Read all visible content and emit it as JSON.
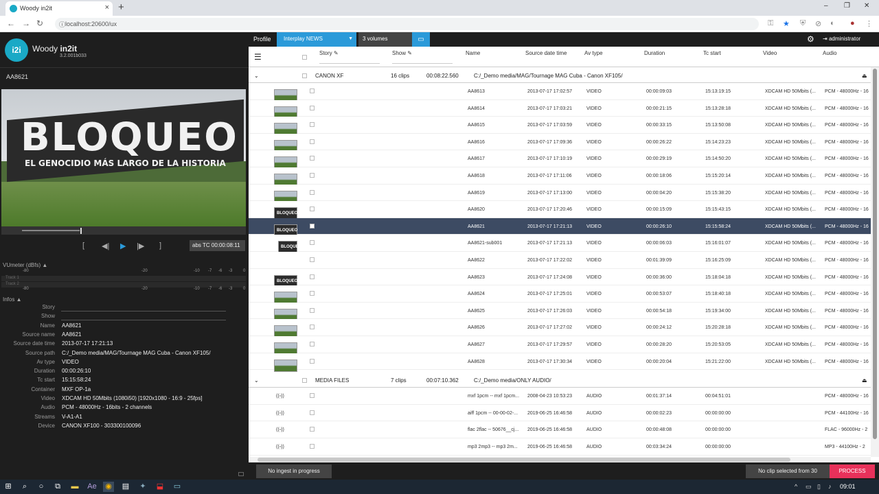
{
  "browser": {
    "tab_title": "Woody in2it",
    "tab_close": "×",
    "new_tab": "+",
    "url": "localhost:20600/ux",
    "window_controls": [
      "–",
      "❐",
      "✕"
    ]
  },
  "app": {
    "logo": "i2i",
    "name_prefix": "Woody ",
    "name_bold": "in2it",
    "version": "3.2.001b033"
  },
  "player": {
    "clip_name": "AA8621",
    "billboard_line1": "BLOQUEO",
    "billboard_line2": "EL GENOCIDIO MÁS LARGO DE LA HISTORIA",
    "timecode": "abs TC 00:00:08:11",
    "progress": 0.24,
    "buttons": [
      "[",
      "◀|",
      "▶",
      "|▶",
      "]"
    ]
  },
  "vumeter": {
    "label": "VUmeter (dBfs) ▲",
    "scale": [
      "-80",
      "-20",
      "-10",
      "-7",
      "-6",
      "-3",
      "0"
    ],
    "tracks": [
      "Track 1",
      "Track 2"
    ]
  },
  "infos": {
    "label": "Infos ▲",
    "fields": [
      {
        "k": "Story",
        "v": ""
      },
      {
        "k": "Show",
        "v": ""
      },
      {
        "k": "Name",
        "v": "AA8621"
      },
      {
        "k": "Source name",
        "v": "AA8621"
      },
      {
        "k": "Source date time",
        "v": "2013-07-17 17:21:13"
      },
      {
        "k": "Source path",
        "v": "C:/_Demo media/MAG/Tournage MAG Cuba - Canon XF105/"
      },
      {
        "k": "Av type",
        "v": "VIDEO"
      },
      {
        "k": "Duration",
        "v": "00:00:26:10"
      },
      {
        "k": "Tc start",
        "v": "15:15:58:24"
      },
      {
        "k": "Container",
        "v": "MXF OP-1a"
      },
      {
        "k": "Video",
        "v": "XDCAM HD 50Mbits (1080i50) [1920x1080 - 16:9 - 25fps]"
      },
      {
        "k": "Audio",
        "v": "PCM - 48000Hz - 16bits - 2 channels"
      },
      {
        "k": "Streams",
        "v": "V-A1-A1"
      },
      {
        "k": "Device",
        "v": "CANON XF100 - 303300100096"
      }
    ]
  },
  "toolbar": {
    "profile": "Profile",
    "profile_value": "Interplay NEWS",
    "volumes": "3 volumes",
    "user": "administrator"
  },
  "columns": [
    "Story",
    "Show",
    "Name",
    "Source date time",
    "Av type",
    "Duration",
    "Tc start",
    "Video",
    "Audio"
  ],
  "groups": [
    {
      "name": "CANON XF",
      "clips": "16 clips",
      "duration": "00:08:22.560",
      "path": "C:/_Demo media/MAG/Tournage MAG Cuba - Canon XF105/",
      "rows": [
        {
          "name": "AA8613",
          "date": "2013-07-17 17:02:57",
          "type": "VIDEO",
          "dur": "00:00:09:03",
          "tc": "15:13:19:15",
          "video": "XDCAM HD 50Mbits (...",
          "audio": "PCM - 48000Hz - 16",
          "thumb": "field"
        },
        {
          "name": "AA8614",
          "date": "2013-07-17 17:03:21",
          "type": "VIDEO",
          "dur": "00:00:21:15",
          "tc": "15:13:28:18",
          "video": "XDCAM HD 50Mbits (...",
          "audio": "PCM - 48000Hz - 16",
          "thumb": "field"
        },
        {
          "name": "AA8615",
          "date": "2013-07-17 17:03:59",
          "type": "VIDEO",
          "dur": "00:00:33:15",
          "tc": "15:13:50:08",
          "video": "XDCAM HD 50Mbits (...",
          "audio": "PCM - 48000Hz - 16",
          "thumb": "field"
        },
        {
          "name": "AA8616",
          "date": "2013-07-17 17:09:36",
          "type": "VIDEO",
          "dur": "00:00:26:22",
          "tc": "15:14:23:23",
          "video": "XDCAM HD 50Mbits (...",
          "audio": "PCM - 48000Hz - 16",
          "thumb": "field"
        },
        {
          "name": "AA8617",
          "date": "2013-07-17 17:10:19",
          "type": "VIDEO",
          "dur": "00:00:29:19",
          "tc": "15:14:50:20",
          "video": "XDCAM HD 50Mbits (...",
          "audio": "PCM - 48000Hz - 16",
          "thumb": "field"
        },
        {
          "name": "AA8618",
          "date": "2013-07-17 17:11:06",
          "type": "VIDEO",
          "dur": "00:00:18:06",
          "tc": "15:15:20:14",
          "video": "XDCAM HD 50Mbits (...",
          "audio": "PCM - 48000Hz - 16",
          "thumb": "field"
        },
        {
          "name": "AA8619",
          "date": "2013-07-17 17:13:00",
          "type": "VIDEO",
          "dur": "00:00:04:20",
          "tc": "15:15:38:20",
          "video": "XDCAM HD 50Mbits (...",
          "audio": "PCM - 48000Hz - 16",
          "thumb": "field"
        },
        {
          "name": "AA8620",
          "date": "2013-07-17 17:20:46",
          "type": "VIDEO",
          "dur": "00:00:15:09",
          "tc": "15:15:43:15",
          "video": "XDCAM HD 50Mbits (...",
          "audio": "PCM - 48000Hz - 16",
          "thumb": "bloqueo"
        },
        {
          "name": "AA8621",
          "date": "2013-07-17 17:21:13",
          "type": "VIDEO",
          "dur": "00:00:26:10",
          "tc": "15:15:58:24",
          "video": "XDCAM HD 50Mbits (...",
          "audio": "PCM - 48000Hz - 16",
          "thumb": "bloqueo",
          "selected": true
        },
        {
          "name": "AA8621-sub001",
          "date": "2013-07-17 17:21:13",
          "type": "VIDEO",
          "dur": "00:00:06:03",
          "tc": "15:16:01:07",
          "video": "XDCAM HD 50Mbits (...",
          "audio": "PCM - 48000Hz - 16",
          "thumb": "bloqueo",
          "sub": true
        },
        {
          "name": "AA8622",
          "date": "2013-07-17 17:22:02",
          "type": "VIDEO",
          "dur": "00:01:39:09",
          "tc": "15:16:25:09",
          "video": "XDCAM HD 50Mbits (...",
          "audio": "PCM - 48000Hz - 16",
          "thumb": "none"
        },
        {
          "name": "AA8623",
          "date": "2013-07-17 17:24:08",
          "type": "VIDEO",
          "dur": "00:00:36:00",
          "tc": "15:18:04:18",
          "video": "XDCAM HD 50Mbits (...",
          "audio": "PCM - 48000Hz - 16",
          "thumb": "bloqueo"
        },
        {
          "name": "AA8624",
          "date": "2013-07-17 17:25:01",
          "type": "VIDEO",
          "dur": "00:00:53:07",
          "tc": "15:18:40:18",
          "video": "XDCAM HD 50Mbits (...",
          "audio": "PCM - 48000Hz - 16",
          "thumb": "field"
        },
        {
          "name": "AA8625",
          "date": "2013-07-17 17:26:03",
          "type": "VIDEO",
          "dur": "00:00:54:18",
          "tc": "15:19:34:00",
          "video": "XDCAM HD 50Mbits (...",
          "audio": "PCM - 48000Hz - 16",
          "thumb": "field"
        },
        {
          "name": "AA8626",
          "date": "2013-07-17 17:27:02",
          "type": "VIDEO",
          "dur": "00:00:24:12",
          "tc": "15:20:28:18",
          "video": "XDCAM HD 50Mbits (...",
          "audio": "PCM - 48000Hz - 16",
          "thumb": "field"
        },
        {
          "name": "AA8627",
          "date": "2013-07-17 17:29:57",
          "type": "VIDEO",
          "dur": "00:00:28:20",
          "tc": "15:20:53:05",
          "video": "XDCAM HD 50Mbits (...",
          "audio": "PCM - 48000Hz - 16",
          "thumb": "field"
        },
        {
          "name": "AA8628",
          "date": "2013-07-17 17:30:34",
          "type": "VIDEO",
          "dur": "00:00:20:04",
          "tc": "15:21:22:00",
          "video": "XDCAM HD 50Mbits (...",
          "audio": "PCM - 48000Hz - 16",
          "thumb": "field"
        }
      ]
    },
    {
      "name": "MEDIA FILES",
      "clips": "7 clips",
      "duration": "00:07:10.362",
      "path": "C:/_Demo media/ONLY AUDIO/",
      "rows": [
        {
          "name": "mxf 1pcm -- mxf 1pcm...",
          "date": "2008-04-23 10:53:23",
          "type": "AUDIO",
          "dur": "00:01:37:14",
          "tc": "00:04:51:01",
          "video": "",
          "audio": "PCM - 48000Hz - 16",
          "thumb": "audio"
        },
        {
          "name": "aiff 1pcm -- 00-00-02-...",
          "date": "2019-06-25 16:46:58",
          "type": "AUDIO",
          "dur": "00:00:02:23",
          "tc": "00:00:00:00",
          "video": "",
          "audio": "PCM - 44100Hz - 16",
          "thumb": "audio"
        },
        {
          "name": "flac 2flac -- 50676__cj...",
          "date": "2019-06-25 16:46:58",
          "type": "AUDIO",
          "dur": "00:00:48:08",
          "tc": "00:00:00:00",
          "video": "",
          "audio": "FLAC - 96000Hz - 2",
          "thumb": "audio"
        },
        {
          "name": "mp3 2mp3 -- mp3 2m...",
          "date": "2019-06-25 16:46:58",
          "type": "AUDIO",
          "dur": "00:03:34:24",
          "tc": "00:00:00:00",
          "video": "",
          "audio": "MP3 - 44100Hz - 2",
          "thumb": "audio"
        }
      ]
    }
  ],
  "footer": {
    "ingest": "No ingest in progress",
    "selection": "No clip selected from 30",
    "process": "PROCESS"
  },
  "taskbar": {
    "clock": "09:01"
  }
}
